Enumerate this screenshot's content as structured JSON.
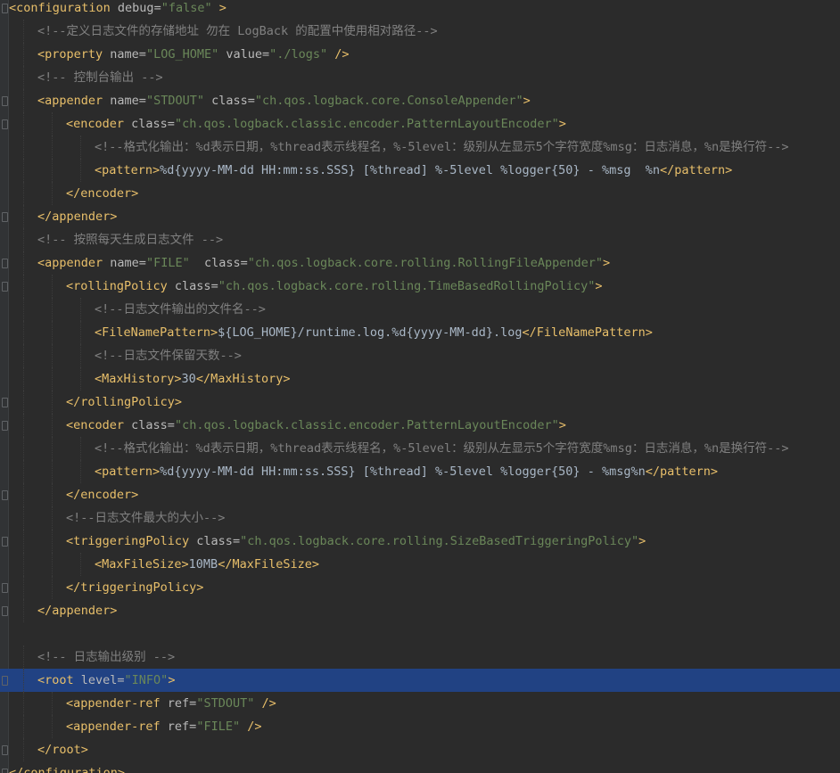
{
  "editor": {
    "language": "XML",
    "highlighted_line": 29
  },
  "lines": [
    {
      "indent": 0,
      "segs": [
        [
          "tag",
          "<configuration"
        ],
        [
          "attr",
          " debug="
        ],
        [
          "val",
          "\"false\""
        ],
        [
          "tag",
          " >"
        ]
      ]
    },
    {
      "indent": 1,
      "segs": [
        [
          "cmt",
          "<!--定义日志文件的存储地址 勿在 LogBack 的配置中使用相对路径-->"
        ]
      ]
    },
    {
      "indent": 1,
      "segs": [
        [
          "tag",
          "<property"
        ],
        [
          "attr",
          " name="
        ],
        [
          "val",
          "\"LOG_HOME\""
        ],
        [
          "attr",
          " value="
        ],
        [
          "val",
          "\"./logs\""
        ],
        [
          "tag",
          " />"
        ]
      ]
    },
    {
      "indent": 1,
      "segs": [
        [
          "cmt",
          "<!-- 控制台输出 -->"
        ]
      ]
    },
    {
      "indent": 1,
      "segs": [
        [
          "tag",
          "<appender"
        ],
        [
          "attr",
          " name="
        ],
        [
          "val",
          "\"STDOUT\""
        ],
        [
          "attr",
          " class="
        ],
        [
          "val",
          "\"ch.qos.logback.core.ConsoleAppender\""
        ],
        [
          "tag",
          ">"
        ]
      ]
    },
    {
      "indent": 2,
      "segs": [
        [
          "tag",
          "<encoder"
        ],
        [
          "attr",
          " class="
        ],
        [
          "val",
          "\"ch.qos.logback.classic.encoder.PatternLayoutEncoder\""
        ],
        [
          "tag",
          ">"
        ]
      ]
    },
    {
      "indent": 3,
      "segs": [
        [
          "cmt",
          "<!--格式化输出：%d表示日期，%thread表示线程名，%-5level：级别从左显示5个字符宽度%msg：日志消息，%n是换行符-->"
        ]
      ]
    },
    {
      "indent": 3,
      "segs": [
        [
          "tag",
          "<pattern>"
        ],
        [
          "txt",
          "%d{yyyy-MM-dd HH:mm:ss.SSS} [%thread] %-5level %logger{50} - %msg  %n"
        ],
        [
          "tag",
          "</pattern>"
        ]
      ]
    },
    {
      "indent": 2,
      "segs": [
        [
          "tag",
          "</encoder>"
        ]
      ]
    },
    {
      "indent": 1,
      "segs": [
        [
          "tag",
          "</appender>"
        ]
      ]
    },
    {
      "indent": 1,
      "segs": [
        [
          "cmt",
          "<!-- 按照每天生成日志文件 -->"
        ]
      ]
    },
    {
      "indent": 1,
      "segs": [
        [
          "tag",
          "<appender"
        ],
        [
          "attr",
          " name="
        ],
        [
          "val",
          "\"FILE\""
        ],
        [
          "attr",
          "  class="
        ],
        [
          "val",
          "\"ch.qos.logback.core.rolling.RollingFileAppender\""
        ],
        [
          "tag",
          ">"
        ]
      ]
    },
    {
      "indent": 2,
      "segs": [
        [
          "tag",
          "<rollingPolicy"
        ],
        [
          "attr",
          " class="
        ],
        [
          "val",
          "\"ch.qos.logback.core.rolling.TimeBasedRollingPolicy\""
        ],
        [
          "tag",
          ">"
        ]
      ]
    },
    {
      "indent": 3,
      "segs": [
        [
          "cmt",
          "<!--日志文件输出的文件名-->"
        ]
      ]
    },
    {
      "indent": 3,
      "segs": [
        [
          "tag",
          "<FileNamePattern>"
        ],
        [
          "txt",
          "${LOG_HOME}/runtime.log.%d{yyyy-MM-dd}.log"
        ],
        [
          "tag",
          "</FileNamePattern>"
        ]
      ]
    },
    {
      "indent": 3,
      "segs": [
        [
          "cmt",
          "<!--日志文件保留天数-->"
        ]
      ]
    },
    {
      "indent": 3,
      "segs": [
        [
          "tag",
          "<MaxHistory>"
        ],
        [
          "txt",
          "30"
        ],
        [
          "tag",
          "</MaxHistory>"
        ]
      ]
    },
    {
      "indent": 2,
      "segs": [
        [
          "tag",
          "</rollingPolicy>"
        ]
      ]
    },
    {
      "indent": 2,
      "segs": [
        [
          "tag",
          "<encoder"
        ],
        [
          "attr",
          " class="
        ],
        [
          "val",
          "\"ch.qos.logback.classic.encoder.PatternLayoutEncoder\""
        ],
        [
          "tag",
          ">"
        ]
      ]
    },
    {
      "indent": 3,
      "segs": [
        [
          "cmt",
          "<!--格式化输出：%d表示日期，%thread表示线程名，%-5level：级别从左显示5个字符宽度%msg：日志消息，%n是换行符-->"
        ]
      ]
    },
    {
      "indent": 3,
      "segs": [
        [
          "tag",
          "<pattern>"
        ],
        [
          "txt",
          "%d{yyyy-MM-dd HH:mm:ss.SSS} [%thread] %-5level %logger{50} - %msg%n"
        ],
        [
          "tag",
          "</pattern>"
        ]
      ]
    },
    {
      "indent": 2,
      "segs": [
        [
          "tag",
          "</encoder>"
        ]
      ]
    },
    {
      "indent": 2,
      "segs": [
        [
          "cmt",
          "<!--日志文件最大的大小-->"
        ]
      ]
    },
    {
      "indent": 2,
      "segs": [
        [
          "tag",
          "<triggeringPolicy"
        ],
        [
          "attr",
          " class="
        ],
        [
          "val",
          "\"ch.qos.logback.core.rolling.SizeBasedTriggeringPolicy\""
        ],
        [
          "tag",
          ">"
        ]
      ]
    },
    {
      "indent": 3,
      "segs": [
        [
          "tag",
          "<MaxFileSize>"
        ],
        [
          "txt",
          "10MB"
        ],
        [
          "tag",
          "</MaxFileSize>"
        ]
      ]
    },
    {
      "indent": 2,
      "segs": [
        [
          "tag",
          "</triggeringPolicy>"
        ]
      ]
    },
    {
      "indent": 1,
      "segs": [
        [
          "tag",
          "</appender>"
        ]
      ]
    },
    {
      "indent": 0,
      "segs": []
    },
    {
      "indent": 1,
      "segs": [
        [
          "cmt",
          "<!-- 日志输出级别 -->"
        ]
      ]
    },
    {
      "indent": 1,
      "segs": [
        [
          "tag",
          "<root"
        ],
        [
          "attr",
          " level="
        ],
        [
          "val",
          "\"INFO\""
        ],
        [
          "tag",
          ">"
        ]
      ]
    },
    {
      "indent": 2,
      "segs": [
        [
          "tag",
          "<appender-ref"
        ],
        [
          "attr",
          " ref="
        ],
        [
          "val",
          "\"STDOUT\""
        ],
        [
          "tag",
          " />"
        ]
      ]
    },
    {
      "indent": 2,
      "segs": [
        [
          "tag",
          "<appender-ref"
        ],
        [
          "attr",
          " ref="
        ],
        [
          "val",
          "\"FILE\""
        ],
        [
          "tag",
          " />"
        ]
      ]
    },
    {
      "indent": 1,
      "segs": [
        [
          "tag",
          "</root>"
        ]
      ]
    },
    {
      "indent": 0,
      "segs": [
        [
          "tag",
          "</configuration>"
        ]
      ]
    }
  ]
}
